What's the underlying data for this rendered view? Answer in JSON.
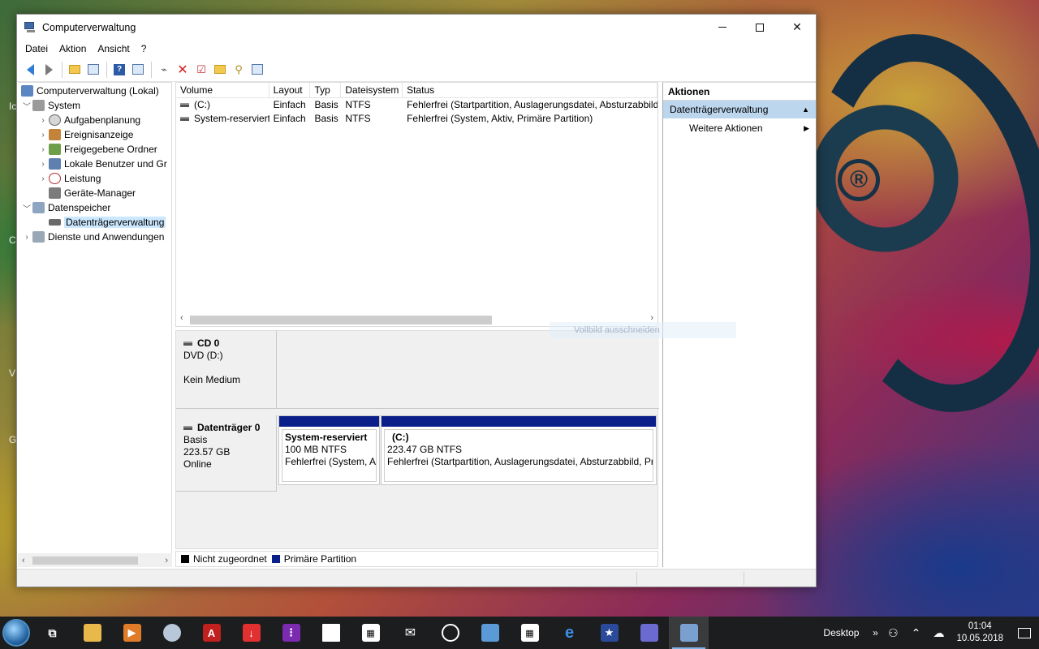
{
  "window": {
    "title": "Computerverwaltung"
  },
  "menu": [
    "Datei",
    "Aktion",
    "Ansicht",
    "?"
  ],
  "tree": {
    "root": "Computerverwaltung (Lokal)",
    "items": [
      {
        "label": "System"
      },
      {
        "label": "Aufgabenplanung"
      },
      {
        "label": "Ereignisanzeige"
      },
      {
        "label": "Freigegebene Ordner"
      },
      {
        "label": "Lokale Benutzer und Gr"
      },
      {
        "label": "Leistung"
      },
      {
        "label": "Geräte-Manager"
      },
      {
        "label": "Datenspeicher"
      },
      {
        "label": "Datenträgerverwaltung"
      },
      {
        "label": "Dienste und Anwendungen"
      }
    ]
  },
  "volumes": {
    "headers": [
      "Volume",
      "Layout",
      "Typ",
      "Dateisystem",
      "Status"
    ],
    "rows": [
      [
        "(C:)",
        "Einfach",
        "Basis",
        "NTFS",
        "Fehlerfrei (Startpartition, Auslagerungsdatei, Absturzabbild"
      ],
      [
        "System-reserviert",
        "Einfach",
        "Basis",
        "NTFS",
        "Fehlerfrei (System, Aktiv, Primäre Partition)"
      ]
    ]
  },
  "tooltip": "Vollbild ausschneiden",
  "disks": {
    "cd": {
      "name": "CD 0",
      "type": "DVD (D:)",
      "media": "Kein Medium"
    },
    "disk0": {
      "name": "Datenträger 0",
      "kind": "Basis",
      "size": "223.57 GB",
      "state": "Online",
      "partitions": [
        {
          "name": "System-reserviert",
          "size": "100 MB NTFS",
          "status": "Fehlerfrei (System, Al"
        },
        {
          "name": "(C:)",
          "size": "223.47 GB NTFS",
          "status": "Fehlerfrei (Startpartition, Auslagerungsdatei, Absturzabbild, Pr"
        }
      ]
    }
  },
  "legend": [
    {
      "label": "Nicht zugeordnet",
      "color": "#000000"
    },
    {
      "label": "Primäre Partition",
      "color": "#0b1f8a"
    }
  ],
  "actions": {
    "header": "Aktionen",
    "section": "Datenträgerverwaltung",
    "more": "Weitere Aktionen"
  },
  "taskbar": {
    "desktop_label": "Desktop",
    "time": "01:04",
    "date": "10.05.2018"
  },
  "desktop_letters": [
    "Ic",
    "C",
    "V",
    "G"
  ]
}
